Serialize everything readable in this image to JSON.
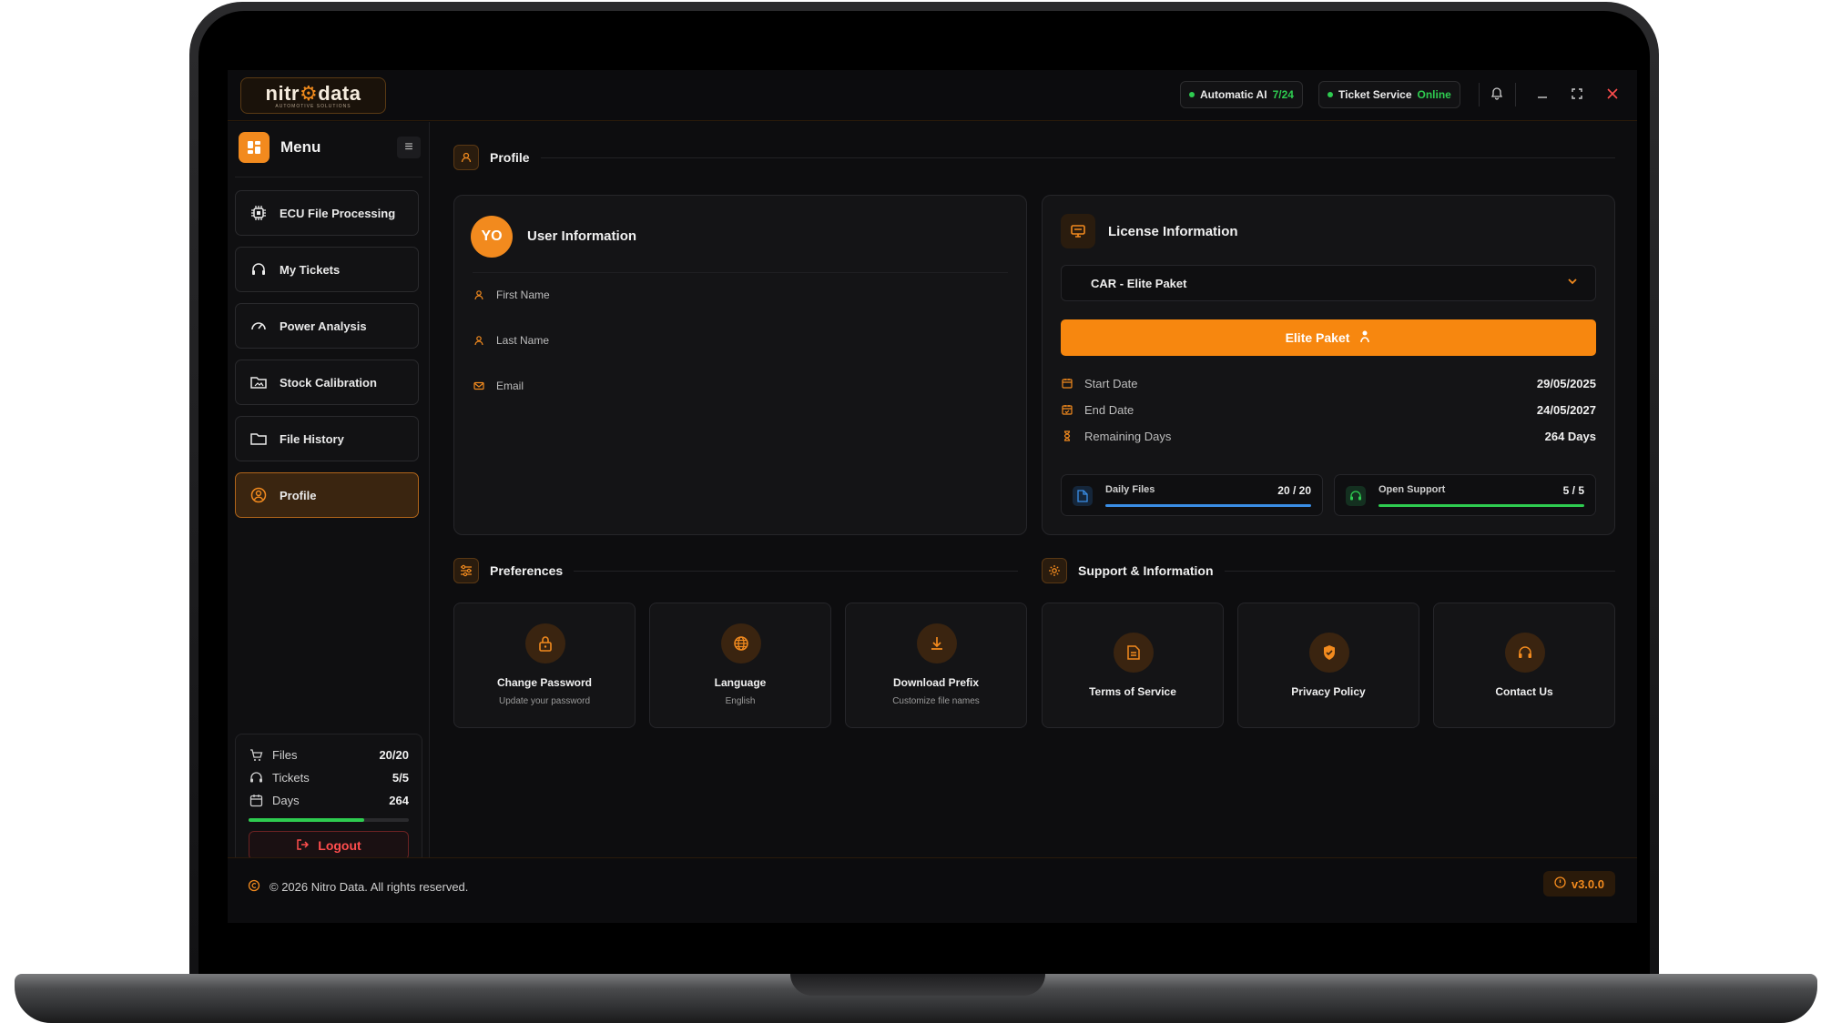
{
  "app": {
    "brand_main": "nitr",
    "brand_accent": "⚙",
    "brand_tail": "data",
    "brand_sub": "AUTOMOTIVE SOLUTIONS"
  },
  "status": {
    "ai_label": "Automatic AI",
    "ai_value": "7/24",
    "ticket_label": "Ticket Service",
    "ticket_value": "Online"
  },
  "menu": {
    "title": "Menu",
    "items": [
      {
        "label": "ECU File Processing",
        "icon": "chip-icon"
      },
      {
        "label": "My Tickets",
        "icon": "headset-icon"
      },
      {
        "label": "Power Analysis",
        "icon": "gauge-icon"
      },
      {
        "label": "Stock Calibration",
        "icon": "folder-image-icon"
      },
      {
        "label": "File History",
        "icon": "folder-icon"
      },
      {
        "label": "Profile",
        "icon": "user-circle-icon"
      }
    ]
  },
  "stats": {
    "files_label": "Files",
    "files_value": "20/20",
    "tickets_label": "Tickets",
    "tickets_value": "5/5",
    "days_label": "Days",
    "days_value": "264",
    "days_progress": 0.72,
    "logout_label": "Logout"
  },
  "profile": {
    "section_title": "Profile",
    "user_card_title": "User Information",
    "avatar_initials": "YO",
    "first_name_label": "First Name",
    "last_name_label": "Last Name",
    "email_label": "Email"
  },
  "license": {
    "title": "License Information",
    "selected": "CAR - Elite Paket",
    "cta_label": "Elite Paket",
    "start_label": "Start Date",
    "start_value": "29/05/2025",
    "end_label": "End Date",
    "end_value": "24/05/2027",
    "remaining_label": "Remaining Days",
    "remaining_value": "264 Days",
    "daily_label": "Daily Files",
    "daily_value": "20 / 20",
    "daily_progress": 1.0,
    "support_label": "Open Support",
    "support_value": "5 / 5",
    "support_progress": 1.0
  },
  "preferences": {
    "title": "Preferences",
    "tiles": [
      {
        "title": "Change Password",
        "subtitle": "Update your password",
        "icon": "lock-icon"
      },
      {
        "title": "Language",
        "subtitle": "English",
        "icon": "globe-icon"
      },
      {
        "title": "Download Prefix",
        "subtitle": "Customize file names",
        "icon": "download-icon"
      }
    ]
  },
  "support": {
    "title": "Support & Information",
    "tiles": [
      {
        "title": "Terms of Service",
        "icon": "document-icon"
      },
      {
        "title": "Privacy Policy",
        "icon": "shield-icon"
      },
      {
        "title": "Contact Us",
        "icon": "headset-icon"
      }
    ]
  },
  "footer": {
    "copyright": "© 2026 Nitro Data. All rights reserved.",
    "version": "v3.0.0"
  },
  "colors": {
    "accent": "#f28a1e",
    "success": "#2ecc50",
    "danger": "#ff4d4d",
    "info": "#3a8ee6"
  }
}
